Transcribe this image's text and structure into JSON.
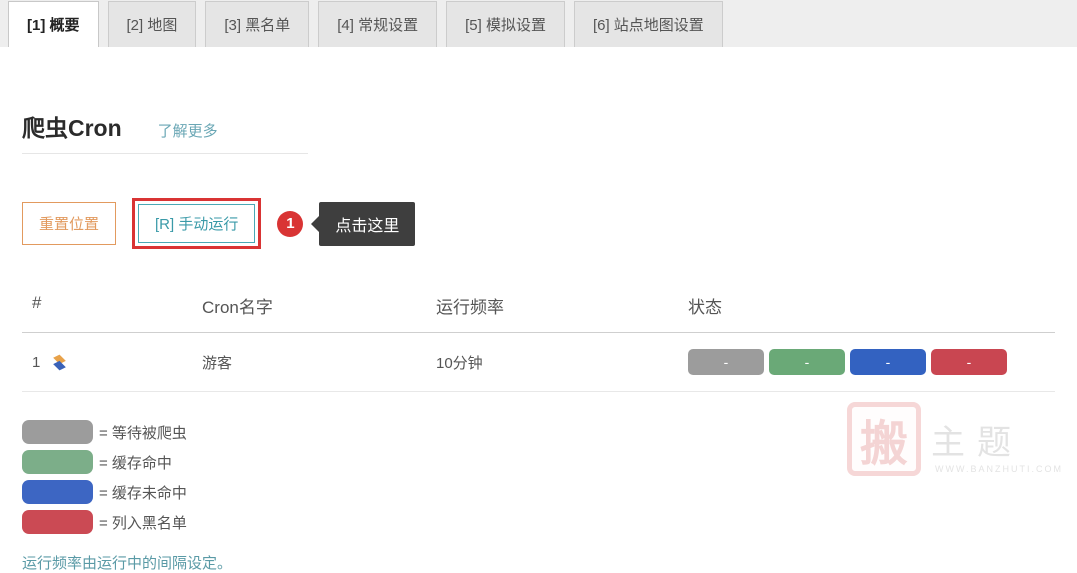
{
  "tabs": {
    "items": [
      {
        "label": "[1] 概要",
        "active": true
      },
      {
        "label": "[2] 地图",
        "active": false
      },
      {
        "label": "[3] 黑名单",
        "active": false
      },
      {
        "label": "[4] 常规设置",
        "active": false
      },
      {
        "label": "[5] 模拟设置",
        "active": false
      },
      {
        "label": "[6] 站点地图设置",
        "active": false
      }
    ]
  },
  "section": {
    "title": "爬虫Cron",
    "learn_more": "了解更多"
  },
  "buttons": {
    "reset": "重置位置",
    "manual": "[R] 手动运行"
  },
  "annotation": {
    "badge": "1",
    "tooltip": "点击这里"
  },
  "table": {
    "headers": {
      "index": "#",
      "name": "Cron名字",
      "freq": "运行频率",
      "status": "状态"
    },
    "rows": [
      {
        "index": "1",
        "name": "游客",
        "freq": "10分钟",
        "status_labels": [
          "-",
          "-",
          "-",
          "-"
        ]
      }
    ]
  },
  "legend": {
    "items": [
      {
        "color": "gray",
        "label": "= 等待被爬虫"
      },
      {
        "color": "green",
        "label": "= 缓存命中"
      },
      {
        "color": "blue",
        "label": "= 缓存未命中"
      },
      {
        "color": "red",
        "label": "= 列入黑名单"
      }
    ]
  },
  "footer": {
    "note": "运行频率由运行中的间隔设定。"
  },
  "watermark": {
    "seal": "搬",
    "text": "主题",
    "sub": "WWW.BANZHUTI.COM"
  }
}
